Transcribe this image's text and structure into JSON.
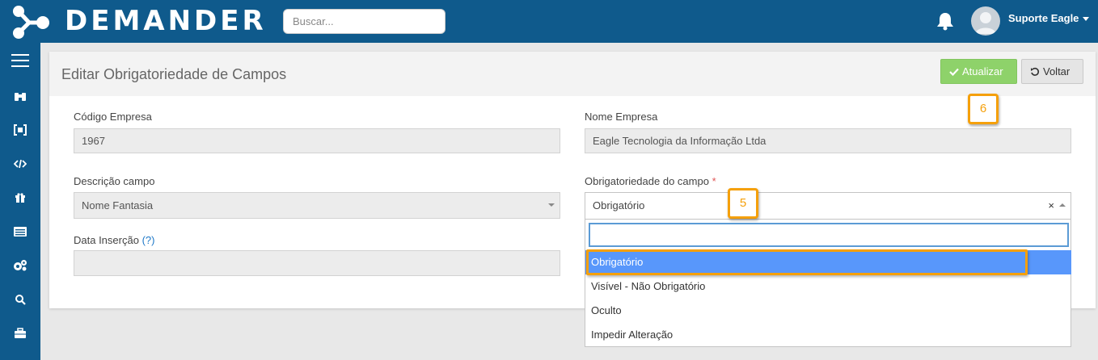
{
  "header": {
    "app_name": "DEMANDER",
    "search_placeholder": "Buscar...",
    "user_name": "Suporte Eagle"
  },
  "sidebar": {
    "items": [
      {
        "icon": "menu-icon"
      },
      {
        "icon": "binoculars-icon"
      },
      {
        "icon": "bracket-icon"
      },
      {
        "icon": "code-icon"
      },
      {
        "icon": "gift-icon"
      },
      {
        "icon": "list-icon"
      },
      {
        "icon": "cogs-icon"
      },
      {
        "icon": "search-icon"
      },
      {
        "icon": "briefcase-icon"
      }
    ]
  },
  "page": {
    "title": "Editar Obrigatoriedade de Campos",
    "update_label": "Atualizar",
    "back_label": "Voltar"
  },
  "form": {
    "company_code_label": "Código Empresa",
    "company_code_value": "1967",
    "company_name_label": "Nome Empresa",
    "company_name_value": "Eagle Tecnologia da Informação Ltda",
    "field_description_label": "Descrição campo",
    "field_description_value": "Nome Fantasia",
    "requirement_label": "Obrigatoriedade do campo",
    "requirement_required_mark": "*",
    "requirement_value": "Obrigatório",
    "requirement_clear": "×",
    "insert_date_label": "Data Inserção",
    "insert_date_help": "(?)",
    "insert_date_value": ""
  },
  "dropdown": {
    "search_value": "",
    "options": [
      "Obrigatório",
      "Visível - Não Obrigatório",
      "Oculto",
      "Impedir Alteração"
    ],
    "active_index": 0
  },
  "callouts": {
    "step5": "5",
    "step6": "6"
  },
  "colors": {
    "primary": "#0f5a8c",
    "update_button": "#8ed26a",
    "highlight": "#f5a00b",
    "option_active": "#5897fb"
  }
}
